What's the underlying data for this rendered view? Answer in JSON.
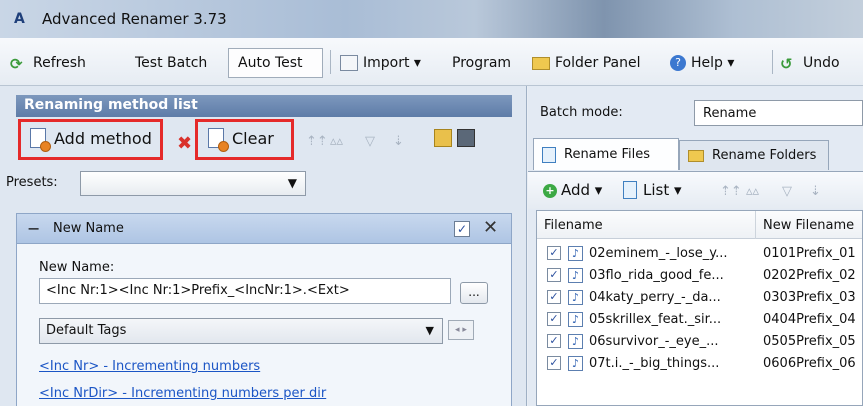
{
  "window": {
    "title": "Advanced Renamer 3.73",
    "app_icon": "A"
  },
  "toolbar": {
    "refresh": "Refresh",
    "test_batch": "Test Batch",
    "auto_test": "Auto Test",
    "import": "Import ▾",
    "program": "Program",
    "folder_panel": "Folder Panel",
    "help": "Help ▾",
    "undo": "Undo"
  },
  "left_panel": {
    "header": "Renaming method list",
    "add_method": "Add method",
    "clear": "Clear",
    "presets_label": "Presets:",
    "presets_value": "",
    "method": {
      "collapse": "−",
      "name": "New Name",
      "enabled_mark": "✓",
      "close": "✕",
      "new_name_label": "New Name:",
      "new_name_value": "<Inc Nr:1><Inc Nr:1>Prefix_<IncNr:1>.<Ext>",
      "browse": "...",
      "tags_select": "Default Tags",
      "tag_links": [
        "<Inc Nr> - Incrementing numbers",
        "<Inc NrDir> - Incrementing numbers per dir"
      ]
    }
  },
  "right_panel": {
    "batch_mode_label": "Batch mode:",
    "batch_mode_value": "Rename",
    "tabs": [
      "Rename Files",
      "Rename Folders"
    ],
    "add": "Add ▾",
    "list": "List ▾",
    "columns": [
      "Filename",
      "New Filename"
    ],
    "rows": [
      {
        "filename": "02eminem_-_lose_y...",
        "new": "0101Prefix_01"
      },
      {
        "filename": "03flo_rida_good_fe...",
        "new": "0202Prefix_02"
      },
      {
        "filename": "04katy_perry_-_da...",
        "new": "0303Prefix_03"
      },
      {
        "filename": "05skrillex_feat._sir...",
        "new": "0404Prefix_04"
      },
      {
        "filename": "06survivor_-_eye_...",
        "new": "0505Prefix_05"
      },
      {
        "filename": "07t.i._-_big_things...",
        "new": "0606Prefix_06"
      }
    ]
  },
  "colors": {
    "highlight": "#e52a2a",
    "link": "#1b55c5",
    "header": "#6a87b2"
  }
}
